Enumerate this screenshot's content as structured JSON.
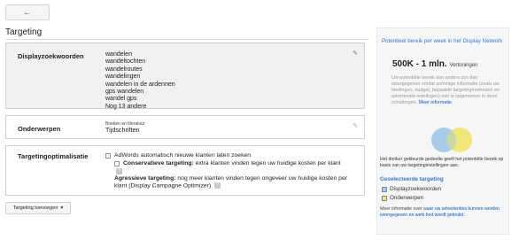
{
  "nav": {
    "back_icon": "arrow-left-icon",
    "back_glyph": "←"
  },
  "page_title": "Targeting",
  "display_keywords": {
    "label": "Displayzoekwoorden",
    "items": [
      "wandelen",
      "wandeltochten",
      "wandelroutes",
      "wandelingen",
      "wandelen in de ardennen",
      "gps wandelen",
      "wandel gps",
      "Nog 13 andere"
    ],
    "edit_icon": "pencil-icon",
    "edit_glyph": "✎"
  },
  "topics": {
    "label": "Onderwerpen",
    "category": "Boeken en literatuur",
    "value": "Tijdschriften",
    "edit_icon": "pencil-icon",
    "edit_glyph": "✎"
  },
  "optimization": {
    "label": "Targetingoptimalisatie",
    "auto_option": "AdWords automatisch nieuwe klanten laten zoeken",
    "conservative_title": "Conservatieve targeting:",
    "conservative_text": "extra klanten vinden tegen uw huidige kosten per klant",
    "aggressive_title": "Agressieve targeting:",
    "aggressive_text": "nog meer klanten vinden tegen ongeveer uw huidige kosten per klant (Display Campagne Optimizer)",
    "help_glyph": "?"
  },
  "add_button": {
    "label": "Targeting toevoegen",
    "caret": "▾"
  },
  "reach_panel": {
    "title": "Potentieel bereik per week in het Display Network",
    "reach_value": "500K - 1 mln.",
    "reach_unit": "Vertoningen",
    "description": "Uw potentiële bereik kan anders zijn dan weergegeven omdat sommige informatie (zoals uw biedingen, budget, bepaalde targetingmethoden en advertentie-indelingen) niet is opgenomen in deze schattingen.",
    "more_info_link": "Meer informatie",
    "venn_note": "Het donker gekleurde gedeelte geeft het potentiële bereik op basis van uw targetinginstellingen aan.",
    "selected_title": "Geselecteerde targeting",
    "legend": [
      {
        "label": "Displayzoekwoorden",
        "color": "#a8cbe8"
      },
      {
        "label": "Onderwerpen",
        "color": "#f0e67a"
      }
    ],
    "more_text": "Meer informatie over",
    "more_link": "waar uw advertenties kunnen worden weergegeven en welk bod wordt gebruikt."
  }
}
